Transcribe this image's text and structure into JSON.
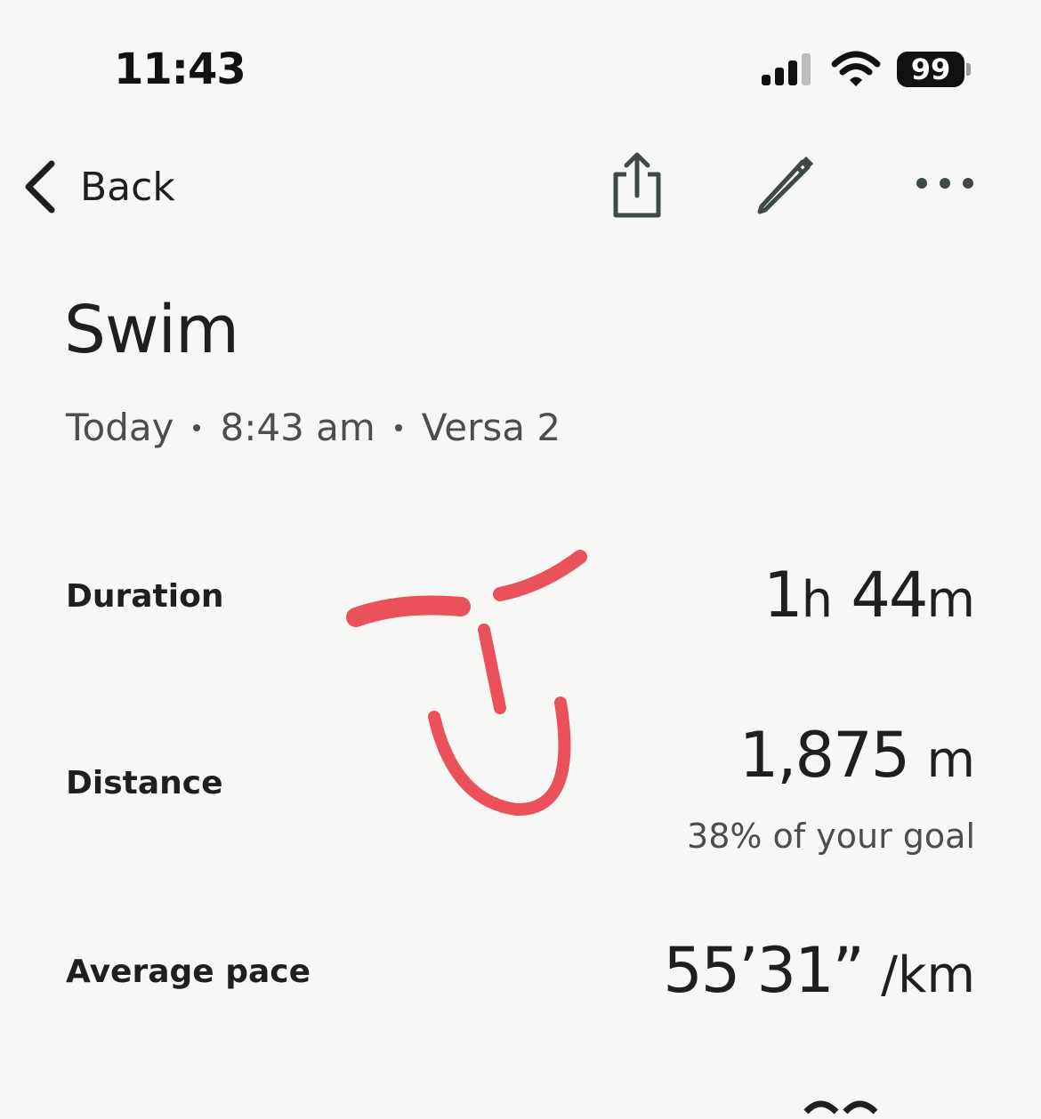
{
  "status_bar": {
    "time": "11:43",
    "battery": "99"
  },
  "nav": {
    "back_label": "Back"
  },
  "activity": {
    "title": "Swim",
    "day": "Today",
    "time": "8:43 am",
    "device": "Versa 2"
  },
  "metrics": {
    "duration": {
      "label": "Duration",
      "hours": "1",
      "hours_unit": "h",
      "minutes": "44",
      "minutes_unit": "m"
    },
    "distance": {
      "label": "Distance",
      "value": "1,875",
      "unit": "m",
      "goal_note": "38% of your goal",
      "goal_fraction": 0.38
    },
    "pace": {
      "label": "Average pace",
      "value": "55’31”",
      "unit": "/km"
    }
  },
  "colors": {
    "background": "#f7f8f6",
    "text": "#1f1f1f",
    "secondary_text": "#4a4f4c",
    "annotation": "#e8343f"
  }
}
